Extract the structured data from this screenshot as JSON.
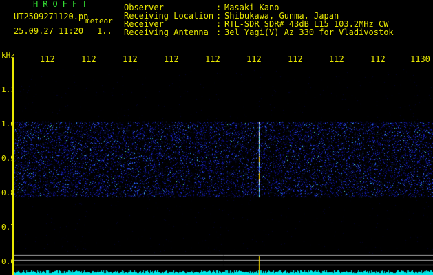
{
  "header": {
    "title": "HROFFT",
    "filename": "UT2509271120.pn",
    "meteor_label": "meteor",
    "date": "25.09.27 11:20",
    "count": "1.."
  },
  "info": {
    "rows": [
      {
        "label": "Observer",
        "sep": ":",
        "value": "Masaki Kano"
      },
      {
        "label": "Receiving Location",
        "sep": ":",
        "value": "Shibukawa, Gunma, Japan"
      },
      {
        "label": "Receiver",
        "sep": ":",
        "value": "RTL-SDR SDR# 43dB L15 103.2MHz CW"
      },
      {
        "label": "Receiving Antenna",
        "sep": ":",
        "value": "3el Yagi(V) Az 330 for Vladivostok"
      }
    ]
  },
  "axis": {
    "unit": "kHz",
    "y_ticks": [
      "1.1",
      "1.0",
      "0.9",
      "0.8",
      "0.7",
      "0.6"
    ],
    "x_ticks": [
      "112",
      "112",
      "112",
      "112",
      "112",
      "112",
      "112",
      "112",
      "112",
      "1130"
    ]
  },
  "colors": {
    "text": "#e8e800",
    "title": "#33dd33",
    "signal": "#0a18c8",
    "trace": "#00e8e8",
    "ref_line": "#aaaaaa",
    "spike": "#ffe000"
  },
  "spectrogram": {
    "band_kHz": [
      0.8,
      1.0
    ],
    "meteor_trail_minute_index": 5
  }
}
